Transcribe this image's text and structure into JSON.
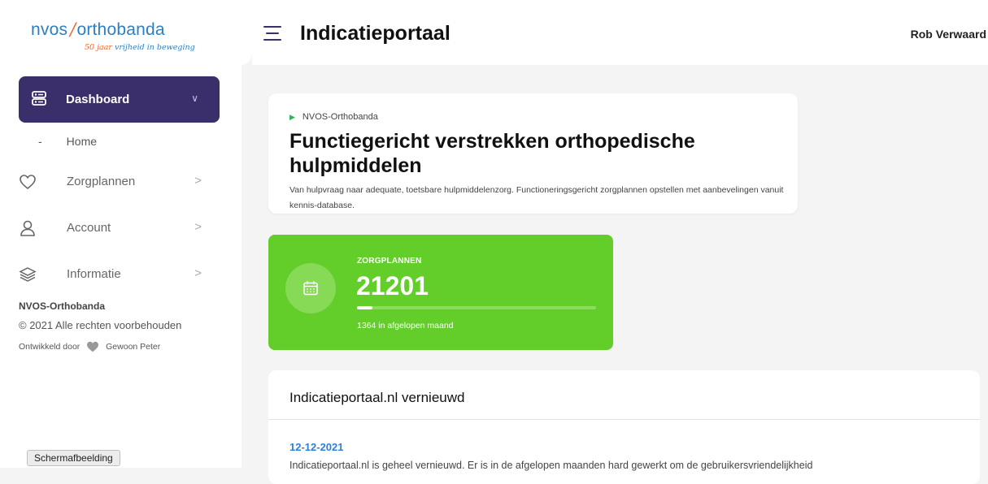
{
  "brand": {
    "logo_left": "nvos",
    "logo_slash": "/",
    "logo_right": "orthobanda",
    "tagline_num": "50 jaar",
    "tagline_rest": " vrijheid in beweging",
    "accent": "#3a2f6a",
    "logo_blue": "#2e7fc1",
    "logo_orange": "#e8672a"
  },
  "sidebar": {
    "dashboard_label": "Dashboard",
    "dashboard_icon": "server-icon",
    "sub_dash": "-",
    "sub_home": "Home",
    "items": [
      {
        "label": "Zorgplannen",
        "icon": "heart-icon"
      },
      {
        "label": "Account",
        "icon": "user-icon"
      },
      {
        "label": "Informatie",
        "icon": "layers-icon"
      }
    ],
    "footer_brand": "NVOS-Orthobanda",
    "footer_copy": "© 2021 Alle rechten voorbehouden",
    "footer_dev_prefix": "Ontwikkeld door",
    "footer_dev_name": "Gewoon Peter"
  },
  "tooltip": "Schermafbeelding",
  "header": {
    "title": "Indicatieportaal",
    "user": "Rob Verwaard"
  },
  "intro": {
    "breadcrumb": "NVOS-Orthobanda",
    "title": "Functiegericht verstrekken orthopedische hulpmiddelen",
    "description": "Van hulpvraag naar adequate, toetsbare hulpmiddelenzorg. Functioneringsgericht zorgplannen opstellen met aanbevelingen vanuit kennis-database."
  },
  "stat": {
    "label": "ZORGPLANNEN",
    "value": "21201",
    "progress": 0.065,
    "subtext": "1364 in afgelopen maand",
    "color": "#63cd2a"
  },
  "news": {
    "heading": "Indicatieportaal.nl vernieuwd",
    "date": "12-12-2021",
    "text": "Indicatieportaal.nl is geheel vernieuwd. Er is in de afgelopen maanden hard gewerkt om de gebruikersvriendelijkheid"
  }
}
